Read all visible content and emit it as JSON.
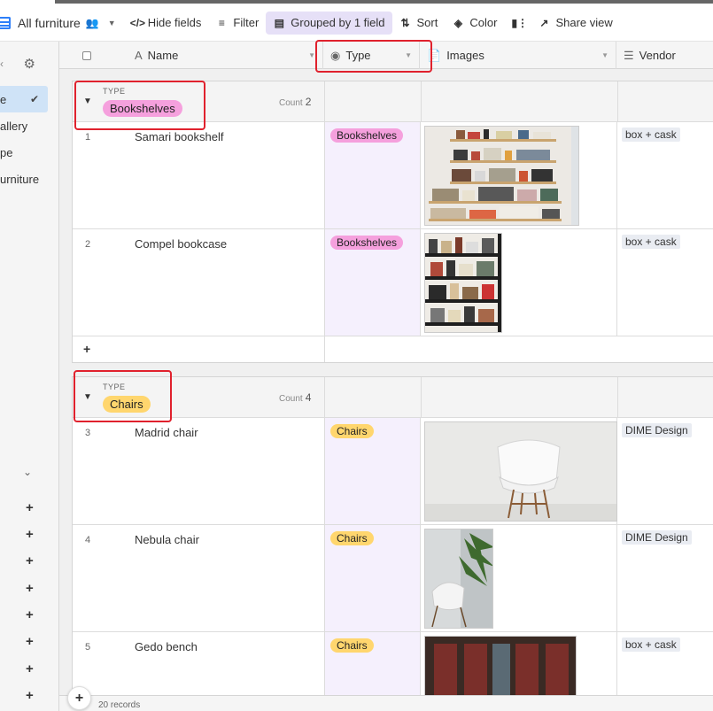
{
  "toolbar": {
    "view_name": "All furniture",
    "hide_fields": "Hide fields",
    "filter": "Filter",
    "grouped": "Grouped by 1 field",
    "sort": "Sort",
    "color": "Color",
    "share_view": "Share view"
  },
  "sidebar": {
    "items": [
      {
        "label": "e",
        "active": true
      },
      {
        "label": "allery"
      },
      {
        "label": "pe"
      },
      {
        "label": "urniture"
      }
    ]
  },
  "columns": {
    "name": "Name",
    "type": "Type",
    "images": "Images",
    "vendor": "Vendor"
  },
  "groups": [
    {
      "label_type": "TYPE",
      "value": "Bookshelves",
      "count_label": "Count",
      "count": "2",
      "color": "#f5a0dd",
      "rows": [
        {
          "num": "1",
          "name": "Samari bookshelf",
          "type": "Bookshelves",
          "vendor": "box + cask"
        },
        {
          "num": "2",
          "name": "Compel bookcase",
          "type": "Bookshelves",
          "vendor": "box + cask"
        }
      ]
    },
    {
      "label_type": "TYPE",
      "value": "Chairs",
      "count_label": "Count",
      "count": "4",
      "color": "#ffd66e",
      "rows": [
        {
          "num": "3",
          "name": "Madrid chair",
          "type": "Chairs",
          "vendor": "DIME Design"
        },
        {
          "num": "4",
          "name": "Nebula chair",
          "type": "Chairs",
          "vendor": "DIME Design"
        },
        {
          "num": "5",
          "name": "Gedo bench",
          "type": "Chairs",
          "vendor": "box + cask"
        }
      ]
    }
  ],
  "footer": {
    "records": "20 records"
  },
  "colors": {
    "accent": "#2d7ff9",
    "annotation": "#e0212d",
    "type_column_bg": "#f5f0fd"
  }
}
